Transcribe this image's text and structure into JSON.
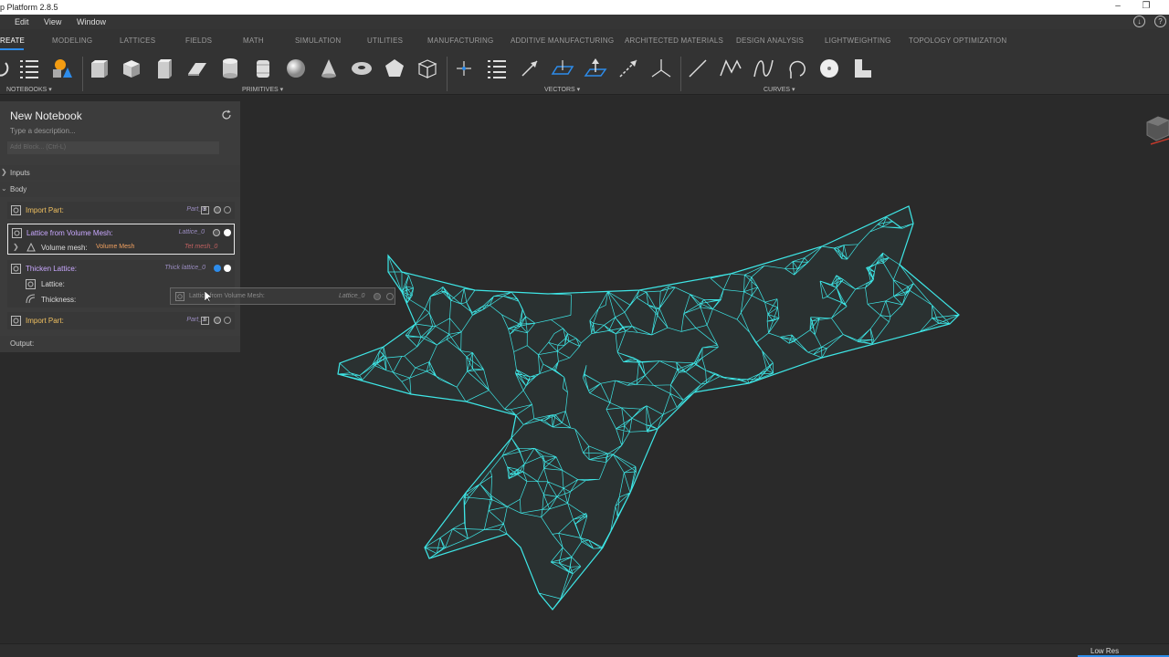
{
  "app": {
    "title": "p Platform 2.8.5"
  },
  "menu": [
    "Edit",
    "View",
    "Window"
  ],
  "tabs": [
    "REATE",
    "MODELING",
    "LATTICES",
    "FIELDS",
    "MATH",
    "SIMULATION",
    "UTILITIES",
    "MANUFACTURING",
    "ADDITIVE MANUFACTURING",
    "ARCHITECTED MATERIALS",
    "DESIGN ANALYSIS",
    "LIGHTWEIGHTING",
    "TOPOLOGY OPTIMIZATION"
  ],
  "toolbar_groups": {
    "notebooks": "NOTEBOOKS",
    "primitives": "PRIMITIVES",
    "vectors": "VECTORS",
    "curves": "CURVES"
  },
  "notebook": {
    "title": "New Notebook",
    "description_placeholder": "Type a description...",
    "add_block_placeholder": "Add Block... (Ctrl-L)",
    "inputs_label": "Inputs",
    "body_label": "Body",
    "output_label": "Output:",
    "blocks": [
      {
        "label": "Import Part:",
        "output": "Part_0",
        "badge": "B"
      },
      {
        "label": "Lattice from Volume Mesh:",
        "output": "Lattice_0",
        "input_label": "Volume mesh:",
        "input_type": "Volume Mesh",
        "input_value": "Tet mesh_0"
      },
      {
        "label": "Thicken Lattice:",
        "output": "Thick lattice_0",
        "input1_label": "Lattice:",
        "input2_label": "Thickness:"
      },
      {
        "label": "Import Part:",
        "output": "Part_1",
        "badge": "B"
      }
    ],
    "dragging_block": {
      "label": "Lattice from Volume Mesh:",
      "output": "Lattice_0"
    }
  },
  "status": {
    "low_res": "Low Res"
  },
  "colors": {
    "accent": "#2d8ceb",
    "lattice": "#3ee6e6",
    "block_label": "#f0c060"
  }
}
